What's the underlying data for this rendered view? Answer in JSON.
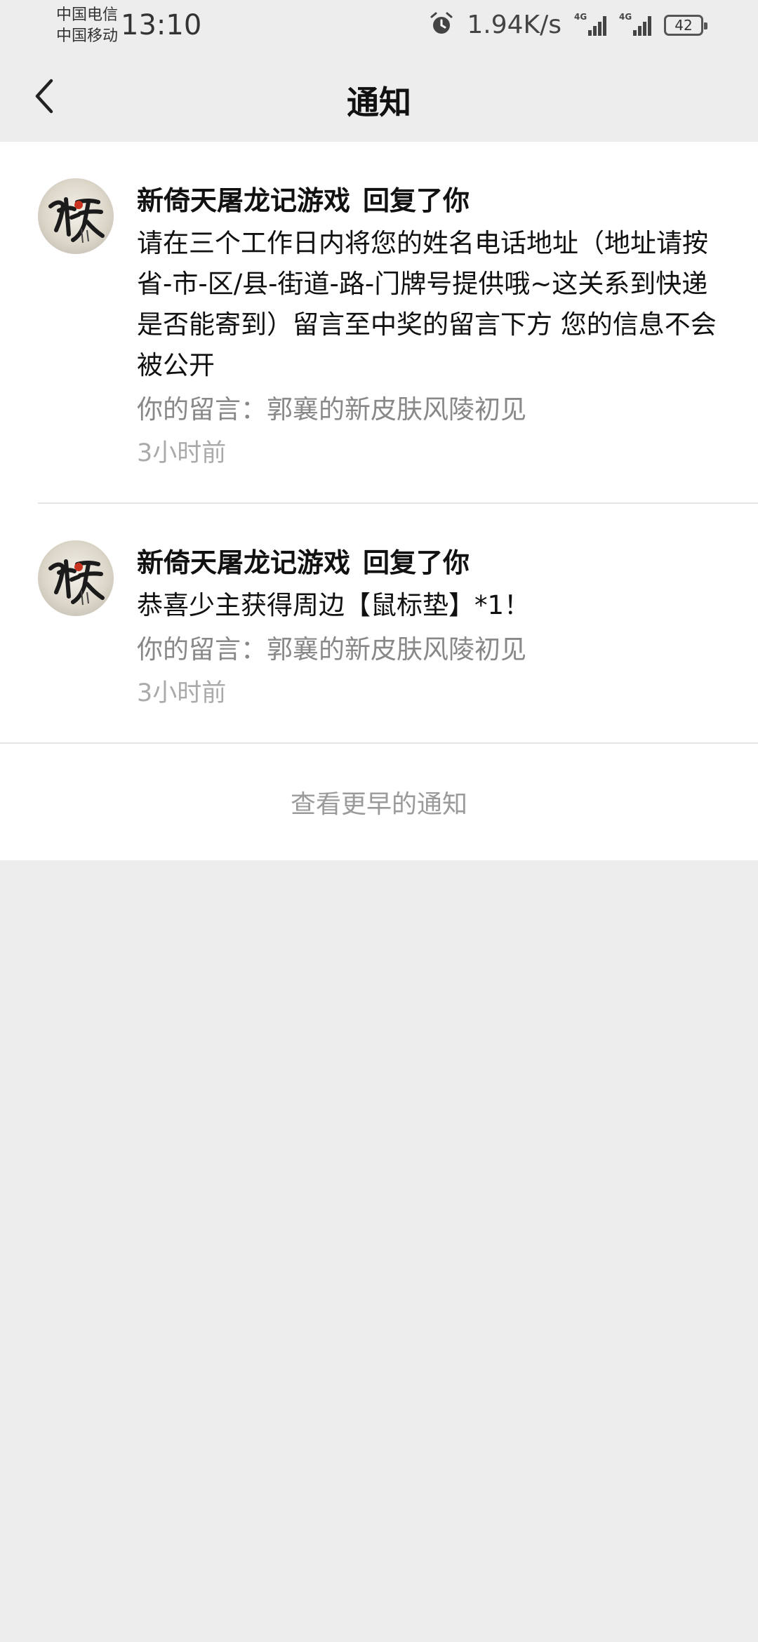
{
  "status_bar": {
    "carrier_1": "中国电信",
    "carrier_2": "中国移动",
    "time": "13:10",
    "net_speed": "1.94K/s",
    "signal_1_label": "4G",
    "signal_2_label": "4G",
    "battery": "42",
    "icons": [
      "alarm-icon",
      "signal-icon",
      "signal-icon",
      "battery-icon"
    ]
  },
  "header": {
    "title": "通知",
    "back_icon": "chevron-left-icon"
  },
  "notifications": [
    {
      "sender": "新倚天屠龙记游戏",
      "action": "回复了你",
      "body": "请在三个工作日内将您的姓名电话地址（地址请按省-市-区/县-街道-路-门牌号提供哦~这关系到快递是否能寄到）留言至中奖的留言下方 您的信息不会被公开",
      "quote": "你的留言：郭襄的新皮肤风陵初见",
      "time": "3小时前"
    },
    {
      "sender": "新倚天屠龙记游戏",
      "action": "回复了你",
      "body": "恭喜少主获得周边【鼠标垫】*1！",
      "quote": "你的留言：郭襄的新皮肤风陵初见",
      "time": "3小时前"
    }
  ],
  "footer": {
    "more_label": "查看更早的通知"
  },
  "colors": {
    "background": "#ededed",
    "card": "#ffffff",
    "secondary_text": "#888888",
    "time_text": "#aaaaaa"
  }
}
